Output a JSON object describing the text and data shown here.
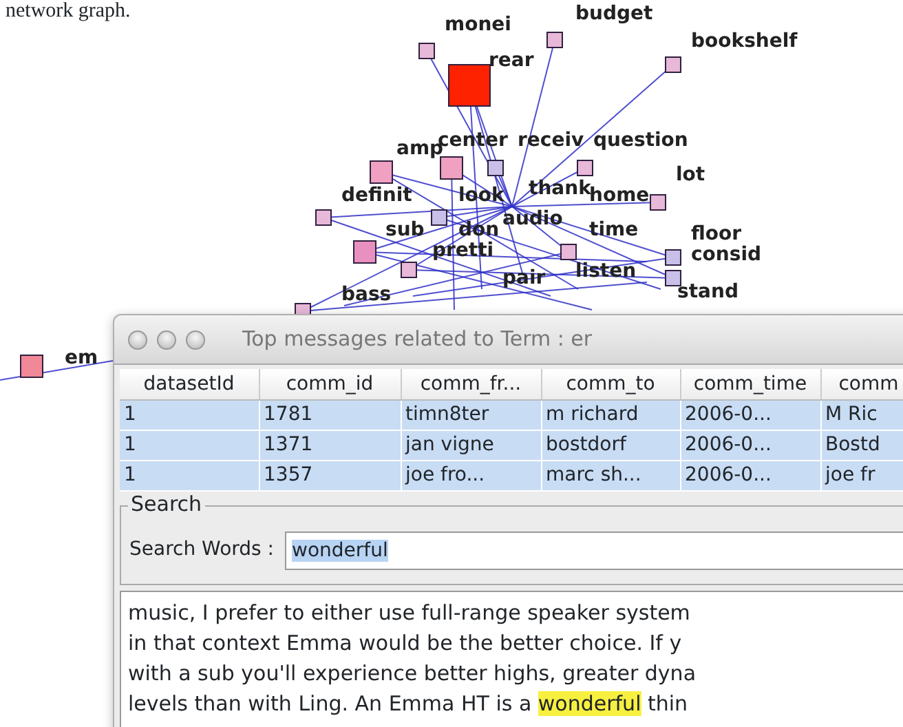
{
  "caption": "network graph.",
  "graph": {
    "labels": [
      "monei",
      "budget",
      "bookshelf",
      "rear",
      "amp",
      "center",
      "receiv",
      "question",
      "lot",
      "definit",
      "look",
      "thank",
      "home",
      "sub",
      "don",
      "audio",
      "time",
      "floor",
      "pretti",
      "consid",
      "listen",
      "pair",
      "bass",
      "stand",
      "em"
    ],
    "nodes": [
      {
        "kind": "small",
        "color": "#e8b8d8"
      },
      {
        "kind": "small",
        "color": "#e8b8d8"
      },
      {
        "kind": "small",
        "color": "#e8b8d8"
      },
      {
        "kind": "large",
        "color": "#ff2200"
      },
      {
        "kind": "medium",
        "color": "#f0a0c0"
      },
      {
        "kind": "medium",
        "color": "#f0a0c0"
      },
      {
        "kind": "small",
        "color": "#c8c0e8"
      },
      {
        "kind": "small",
        "color": "#e8b8d8"
      },
      {
        "kind": "small",
        "color": "#e8b8d8"
      },
      {
        "kind": "small",
        "color": "#e8b8d8"
      },
      {
        "kind": "small",
        "color": "#c8c0e8"
      },
      {
        "kind": "small",
        "color": "#e8b8d8"
      },
      {
        "kind": "medium",
        "color": "#e890c0"
      },
      {
        "kind": "small",
        "color": "#c8c0e8"
      },
      {
        "kind": "small",
        "color": "#e8b8d8"
      },
      {
        "kind": "small",
        "color": "#c8c0e8"
      },
      {
        "kind": "small",
        "color": "#e8b8d8"
      },
      {
        "kind": "medium",
        "color": "#f08898"
      }
    ]
  },
  "window": {
    "title": "Top messages related to Term : er",
    "table": {
      "columns": [
        "datasetId",
        "comm_id",
        "comm_fr...",
        "comm_to",
        "comm_time",
        "comm"
      ],
      "rows": [
        {
          "cells": [
            "1",
            "1781",
            "timn8ter",
            "m richard",
            "2006-0...",
            "M Ric"
          ],
          "selected": true
        },
        {
          "cells": [
            "1",
            "1371",
            "jan vigne",
            "bostdorf",
            "2006-0...",
            "Bostd"
          ],
          "selected": true
        },
        {
          "cells": [
            "1",
            "1357",
            "joe fro...",
            "marc sh...",
            "2006-0...",
            "joe fr"
          ],
          "selected": true
        }
      ]
    },
    "search": {
      "legend": "Search",
      "label": "Search Words :",
      "value": "wonderful",
      "value_selected": true
    },
    "message_lines": [
      [
        {
          "text": "music, I prefer to either use full-range speaker system",
          "highlighted": false
        }
      ],
      [
        {
          "text": "in that context Emma would be the better choice.  If y",
          "highlighted": false
        }
      ],
      [
        {
          "text": "with a sub you'll experience better highs, greater dyna",
          "highlighted": false
        }
      ],
      [
        {
          "text": "levels than with Ling. An Emma HT is a ",
          "highlighted": false
        },
        {
          "text": "wonderful",
          "highlighted": true
        },
        {
          "text": " thin",
          "highlighted": false
        }
      ]
    ]
  }
}
